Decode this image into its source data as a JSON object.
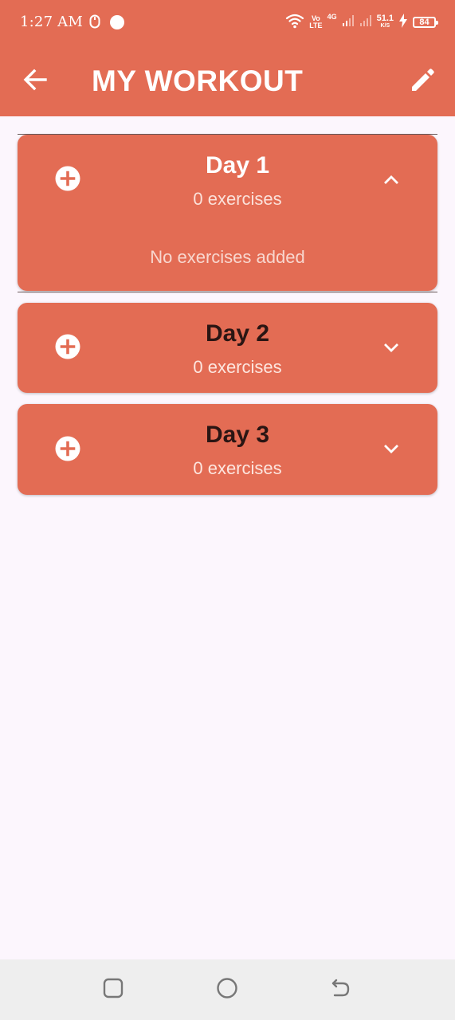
{
  "status_bar": {
    "time": "1:27 AM",
    "volte_top": "Vo",
    "volte_bottom": "LTE",
    "network": "4G",
    "speed_value": "51.1",
    "speed_unit": "K/S",
    "battery": "84"
  },
  "app_bar": {
    "title": "MY WORKOUT",
    "back_icon": "arrow-left-icon",
    "edit_icon": "pencil-icon"
  },
  "days": [
    {
      "title": "Day 1",
      "subtitle": "0 exercises",
      "expanded": true,
      "empty_message": "No exercises added"
    },
    {
      "title": "Day 2",
      "subtitle": "0 exercises",
      "expanded": false
    },
    {
      "title": "Day 3",
      "subtitle": "0 exercises",
      "expanded": false
    }
  ],
  "nav_bar": {
    "recents_icon": "square-icon",
    "home_icon": "circle-icon",
    "back_icon": "return-icon"
  },
  "colors": {
    "primary": "#e36c54",
    "background": "#fcf6fd",
    "nav_background": "#eeeeee",
    "dark_text": "#2a1513"
  }
}
